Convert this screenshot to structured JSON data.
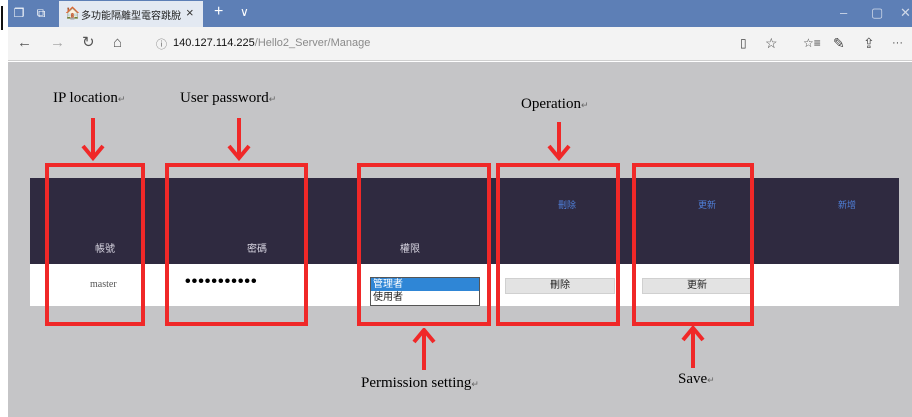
{
  "browser": {
    "tab": {
      "title": "多功能隔離型電容跳脫計",
      "close_glyph": "×",
      "favicon": "🏠"
    },
    "new_tab_glyph": "+",
    "tabs_dropdown_glyph": "∨",
    "window_controls": {
      "minimize": "–",
      "maximize": "▢",
      "close": "✕"
    },
    "nav": {
      "back": "←",
      "forward": "→",
      "refresh": "↻",
      "home": "⌂"
    },
    "address": {
      "info_glyph": "ⓘ",
      "host": "140.127.114.225",
      "path": "/Hello2_Server/Manage"
    },
    "toolbar": {
      "reading_view": "▯",
      "favorite": "☆",
      "favorites_hub": "☆≡",
      "notes": "✎",
      "share": "⇪",
      "more": "···"
    }
  },
  "table": {
    "headers": {
      "account": "帳號",
      "password": "密碼",
      "permission": "權限"
    },
    "links": {
      "delete": "刪除",
      "update": "更新",
      "add": "新增"
    },
    "row": {
      "username": "master",
      "password_mask": "•••••••••••",
      "permission_options": [
        "管理者",
        "使用者"
      ],
      "permission_selected": "管理者",
      "delete_label": "刪除",
      "update_label": "更新"
    }
  },
  "annotations": {
    "ip_location": "IP location",
    "user_password": "User password",
    "operation": "Operation",
    "permission_setting": "Permission setting",
    "save": "Save",
    "return_mark": "↵"
  },
  "colors": {
    "annotation_red": "#f02828",
    "header_band": "#2f2a40",
    "link_blue": "#4f7fd8",
    "tab_strip": "#5d7fb6",
    "page_bg": "#c5c5c7"
  }
}
